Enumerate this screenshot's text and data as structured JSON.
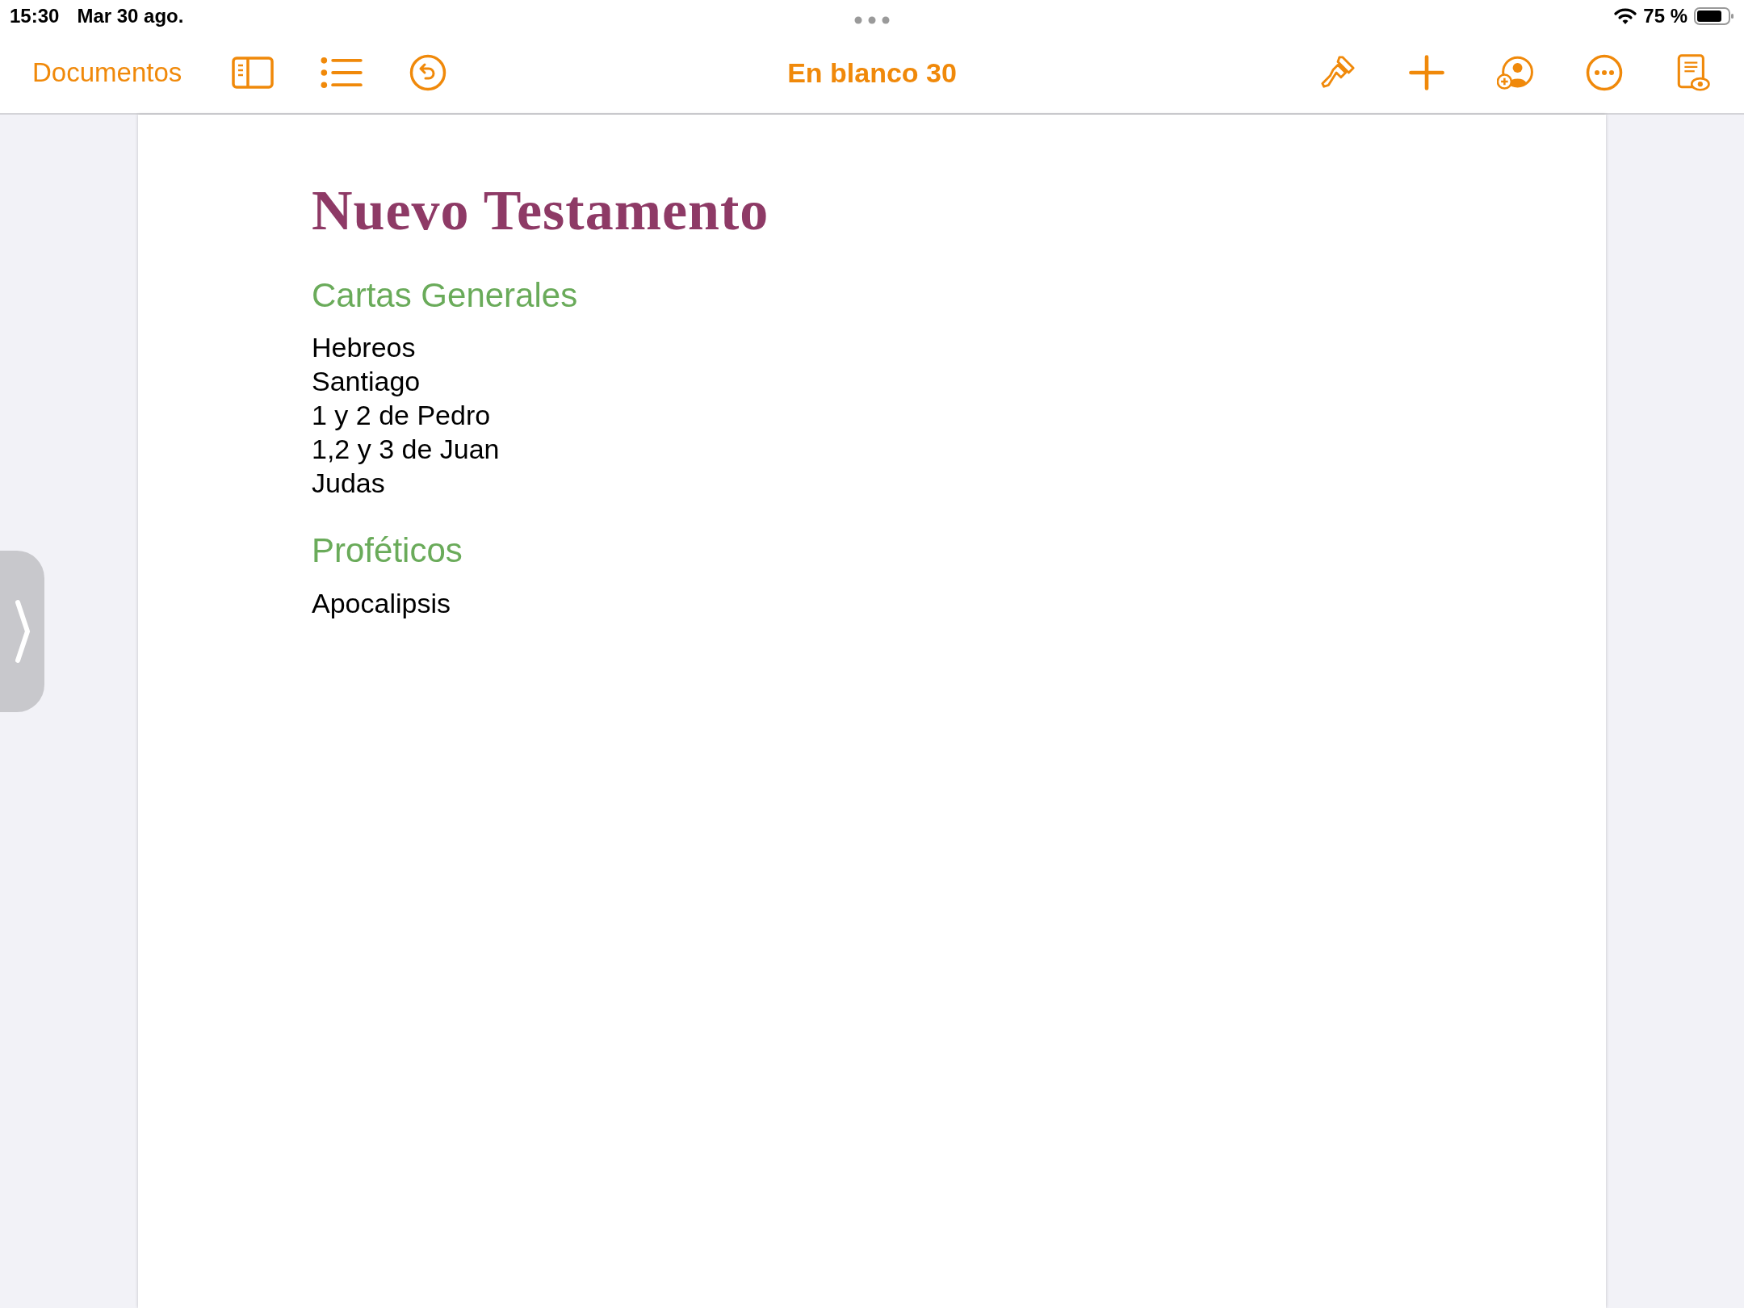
{
  "status_bar": {
    "time": "15:30",
    "date": "Mar 30 ago.",
    "battery": "75 %"
  },
  "toolbar": {
    "back_label": "Documentos",
    "title": "En blanco 30"
  },
  "document": {
    "title": "Nuevo Testamento",
    "sections": [
      {
        "heading": "Cartas Generales",
        "lines": [
          "Hebreos",
          "Santiago",
          "1 y 2 de Pedro",
          "1,2 y 3 de Juan",
          "Judas"
        ]
      },
      {
        "heading": "Proféticos",
        "lines": [
          "Apocalipsis"
        ]
      }
    ]
  }
}
